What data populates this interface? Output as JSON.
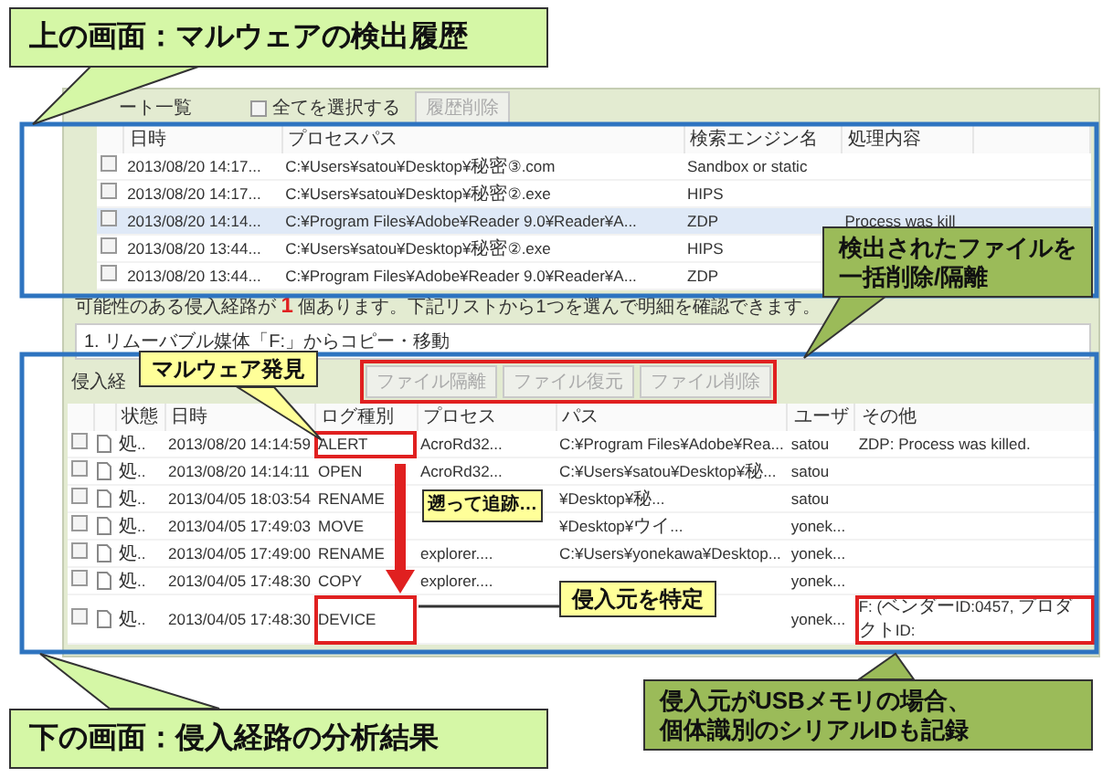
{
  "history": {
    "tab_label": "ート一覧",
    "select_all": {
      "label": "全てを選択する",
      "checked": false
    },
    "delete_button": {
      "label": "履歴削除",
      "disabled": true
    },
    "columns": [
      "日時",
      "プロセスパス",
      "検索エンジン名",
      "処理内容"
    ],
    "rows": [
      {
        "checked": false,
        "selected": false,
        "datetime": "2013/08/20 14:17...",
        "path": "C:¥Users¥satou¥Desktop¥秘密③.com",
        "engine": "Sandbox or static"
      },
      {
        "checked": false,
        "selected": false,
        "datetime": "2013/08/20 14:17...",
        "path": "C:¥Users¥satou¥Desktop¥秘密②.exe",
        "engine": "HIPS"
      },
      {
        "checked": false,
        "selected": true,
        "datetime": "2013/08/20 14:14...",
        "path": "C:¥Program Files¥Adobe¥Reader 9.0¥Reader¥A...",
        "engine": "ZDP",
        "action": "Process was kill"
      },
      {
        "checked": false,
        "selected": false,
        "datetime": "2013/08/20 13:44...",
        "path": "C:¥Users¥satou¥Desktop¥秘密②.exe",
        "engine": "HIPS"
      },
      {
        "checked": false,
        "selected": false,
        "datetime": "2013/08/20 13:44...",
        "path": "C:¥Program Files¥Adobe¥Reader 9.0¥Reader¥A...",
        "engine": "ZDP"
      }
    ]
  },
  "summary": {
    "text": "可能性のある侵入経路が **1** 個あります。下記リストから1つを選んで明細を確認できます。"
  },
  "routes": [
    {
      "label": "1. リムーバブル媒体「F:」からコピー・移動",
      "selected": false
    }
  ],
  "route_detail": {
    "label": "侵入経",
    "buttons": [
      {
        "label": "ファイル隔離",
        "disabled": true
      },
      {
        "label": "ファイル復元",
        "disabled": true
      },
      {
        "label": "ファイル削除",
        "disabled": true
      }
    ],
    "columns": [
      "状態",
      "日時",
      "ログ種別",
      "プロセス",
      "パス",
      "ユーザ",
      "その他"
    ],
    "rows": [
      {
        "checked": false,
        "state": "処..",
        "datetime": "2013/08/20 14:14:59",
        "log_type": "ALERT",
        "log_flagged": true,
        "process": "AcroRd32...",
        "path": "C:¥Program Files¥Adobe¥Rea...",
        "user": "satou",
        "other": "ZDP: Process was killed.",
        "other_flagged": false
      },
      {
        "checked": false,
        "state": "処..",
        "datetime": "2013/08/20 14:14:11",
        "log_type": "OPEN",
        "log_flagged": false,
        "process": "AcroRd32...",
        "path": "C:¥Users¥satou¥Desktop¥秘...",
        "user": "satou",
        "other_flagged": false
      },
      {
        "checked": false,
        "state": "処..",
        "datetime": "2013/04/05 18:03:54",
        "log_type": "RENAME",
        "log_flagged": false,
        "path": "¥Desktop¥秘...",
        "user": "satou",
        "other_flagged": false
      },
      {
        "checked": false,
        "state": "処..",
        "datetime": "2013/04/05 17:49:03",
        "log_type": "MOVE",
        "log_flagged": false,
        "path": "¥Desktop¥ウイ...",
        "user": "yonek...",
        "other_flagged": false
      },
      {
        "checked": false,
        "state": "処..",
        "datetime": "2013/04/05 17:49:00",
        "log_type": "RENAME",
        "log_flagged": false,
        "process": "explorer....",
        "path": "C:¥Users¥yonekawa¥Desktop...",
        "user": "yonek...",
        "other_flagged": false
      },
      {
        "checked": false,
        "state": "処..",
        "datetime": "2013/04/05 17:48:30",
        "log_type": "COPY",
        "log_flagged": false,
        "process": "explorer....",
        "user": "yonek...",
        "other_flagged": false
      },
      {
        "checked": false,
        "state": "処..",
        "datetime": "2013/04/05 17:48:30",
        "log_type": "DEVICE",
        "log_flagged": true,
        "user": "yonek...",
        "other": "F: (ベンダーID:0457, プロダクトID:",
        "other_flagged": true
      }
    ]
  },
  "callouts": [
    {
      "kind": "title",
      "lines": [
        "上の画面：マルウェアの検出履歴"
      ]
    },
    {
      "kind": "note",
      "lines": [
        "検出されたファイルを",
        "一括削除/隔離"
      ]
    },
    {
      "kind": "tag",
      "lines": [
        "マルウェア発見"
      ]
    },
    {
      "kind": "tag",
      "lines": [
        "遡って追跡…"
      ]
    },
    {
      "kind": "tag",
      "lines": [
        "侵入元を特定"
      ]
    },
    {
      "kind": "title",
      "lines": [
        "下の画面：侵入経路の分析結果"
      ]
    },
    {
      "kind": "note",
      "lines": [
        "侵入元がUSBメモリの場合、",
        "個体識別のシリアルIDも記録"
      ]
    }
  ]
}
